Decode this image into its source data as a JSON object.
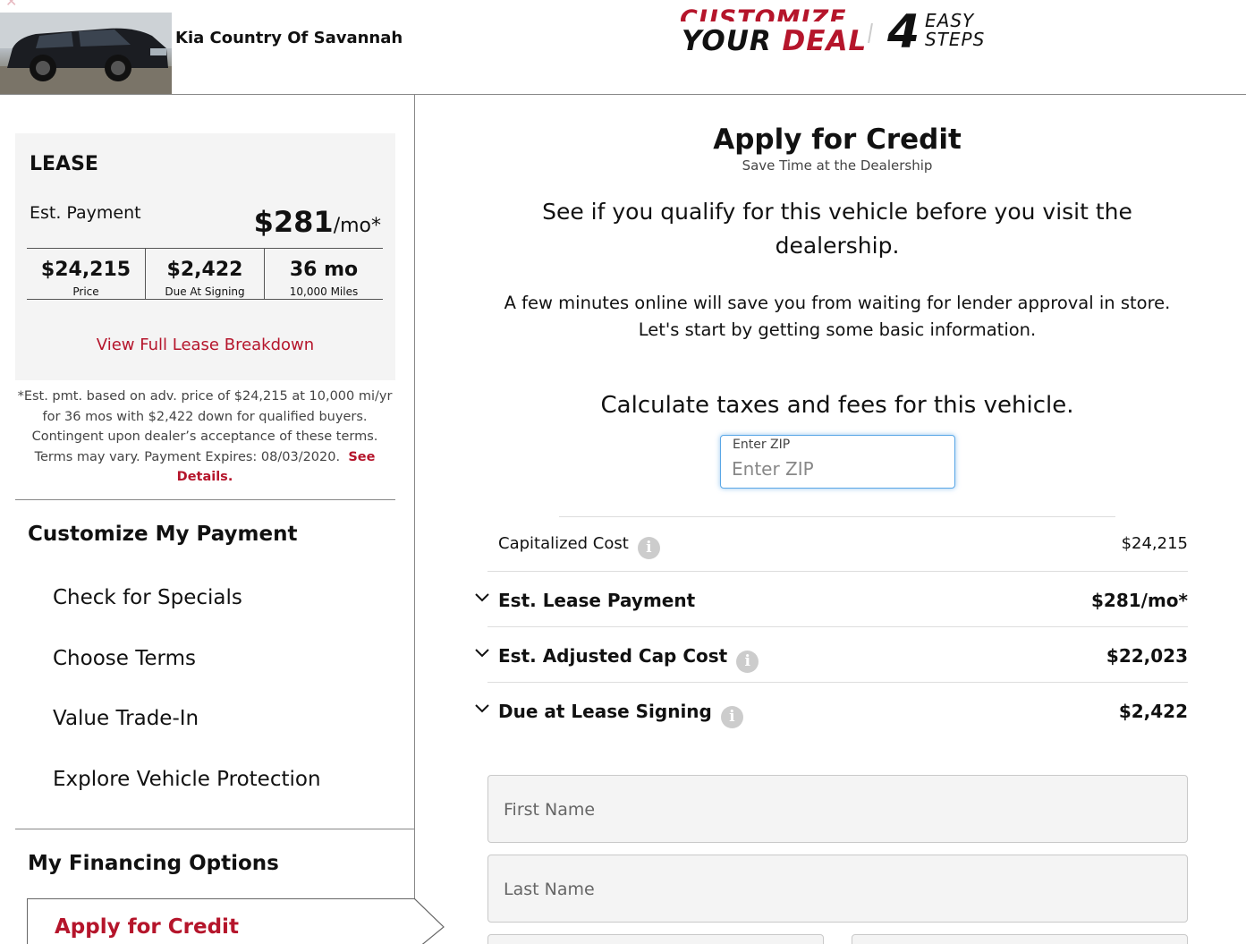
{
  "header": {
    "dealer_name": "Kia Country Of Savannah",
    "banner_line1": "CUSTOMIZE",
    "banner_your": "YOUR",
    "banner_deal": "DEAL",
    "banner_number": "4",
    "banner_easy": "EASY",
    "banner_steps": "STEPS"
  },
  "lease": {
    "title": "LEASE",
    "est_label": "Est. Payment",
    "est_amount": "$281",
    "est_unit": "/mo*",
    "stats": [
      {
        "value": "$24,215",
        "label": "Price"
      },
      {
        "value": "$2,422",
        "label": "Due At Signing"
      },
      {
        "value": "36 mo",
        "label": "10,000 Miles"
      }
    ],
    "breakdown_link": "View Full Lease Breakdown",
    "disclaimer": "*Est. pmt. based on adv. price of $24,215 at 10,000 mi/yr for 36 mos with $2,422 down for qualified buyers. Contingent upon dealer’s acceptance of these terms. Terms may vary. Payment Expires: 08/03/2020.",
    "see_details": "See Details."
  },
  "sidebar": {
    "customize_heading": "Customize My Payment",
    "items": [
      {
        "label": "Check for Specials"
      },
      {
        "label": "Choose Terms"
      },
      {
        "label": "Value Trade-In"
      },
      {
        "label": "Explore Vehicle Protection"
      }
    ],
    "financing_heading": "My Financing Options",
    "apply_label": "Apply for Credit"
  },
  "main": {
    "title": "Apply for Credit",
    "subtitle": "Save Time at the Dealership",
    "lead": "See if you qualify for this vehicle before you visit the dealership.",
    "para_line1": "A few minutes online will save you from waiting for lender approval in store.",
    "para_line2": "Let's start by getting some basic information.",
    "calc_heading": "Calculate taxes and fees for this vehicle.",
    "zip": {
      "label": "Enter ZIP",
      "placeholder": "Enter ZIP",
      "value": ""
    },
    "rows": [
      {
        "label": "Capitalized Cost",
        "value": "$24,215"
      },
      {
        "label": "Est. Lease Payment",
        "value": "$281/mo*"
      },
      {
        "label": "Est. Adjusted Cap Cost",
        "value": "$22,023"
      },
      {
        "label": "Due at Lease Signing",
        "value": "$2,422"
      }
    ],
    "first_name_placeholder": "First Name",
    "last_name_placeholder": "Last Name"
  },
  "colors": {
    "accent": "#b5152b",
    "focus": "#5aa7e6"
  },
  "icons": [
    "close-icon",
    "info-icon",
    "chevron-down-icon",
    "chevron-right-icon"
  ]
}
